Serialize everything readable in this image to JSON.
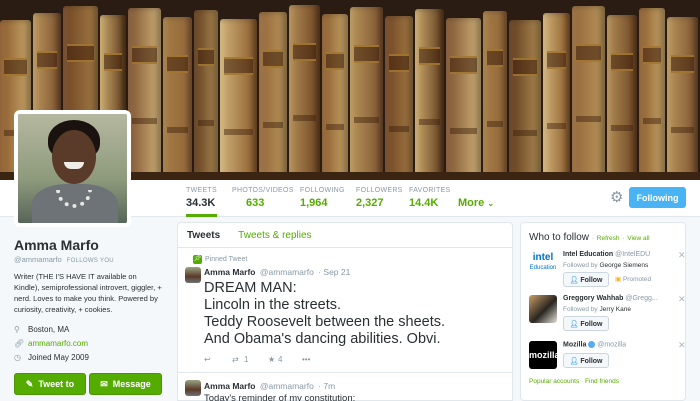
{
  "header": {
    "stats": [
      {
        "label": "TWEETS",
        "value": "34.3K",
        "active": true
      },
      {
        "label": "PHOTOS/VIDEOS",
        "value": "633"
      },
      {
        "label": "FOLLOWING",
        "value": "1,964"
      },
      {
        "label": "FOLLOWERS",
        "value": "2,327"
      },
      {
        "label": "FAVORITES",
        "value": "14.4K"
      }
    ],
    "more_label": "More",
    "following_button": "Following"
  },
  "profile": {
    "name": "Amma Marfo",
    "handle": "@ammamarfo",
    "follows_you": "FOLLOWS YOU",
    "bio": "Writer (THE I'S HAVE IT available on Kindle), semiprofessional introvert, giggler, + nerd. Loves to make you think. Powered by curiosity, creativity, + cookies.",
    "location": "Boston, MA",
    "website": "ammamarfo.com",
    "joined": "Joined May 2009",
    "tweet_to_label": "Tweet to",
    "message_label": "Message"
  },
  "timeline": {
    "tabs": [
      "Tweets",
      "Tweets & replies"
    ],
    "pinned_label": "Pinned Tweet",
    "tweets": [
      {
        "name": "Amma Marfo",
        "handle": "@ammamarfo",
        "time": "· Sep 21",
        "text_lines": [
          "DREAM MAN:",
          "Lincoln in the streets.",
          "Teddy Roosevelt between the sheets.",
          "And Obama's dancing abilities. Obvi."
        ],
        "retweets": "1",
        "favorites": "4"
      },
      {
        "name": "Amma Marfo",
        "handle": "@ammamarfo",
        "time": "· 7m",
        "text_lines": [
          "Today's reminder of my constitution:"
        ]
      }
    ]
  },
  "who_to_follow": {
    "title": "Who to follow",
    "refresh": "Refresh",
    "view_all": "View all",
    "items": [
      {
        "name": "Intel Education",
        "handle": "@IntelEDU",
        "followed_by": "George Siemens",
        "promoted": "Promoted",
        "logo_text": "intel",
        "logo_sub": "Education"
      },
      {
        "name": "Greggory Wahhab",
        "handle": "@Gregg...",
        "followed_by": "Jerry Kane"
      },
      {
        "name": "Mozilla",
        "handle": "@mozilla",
        "logo_text": "mozilla"
      }
    ],
    "followed_by_prefix": "Followed by",
    "follow_label": "Follow",
    "footer_popular": "Popular accounts",
    "footer_find": "Find friends"
  },
  "colors": {
    "accent": "#55ac00",
    "blue": "#4ab3f4"
  }
}
